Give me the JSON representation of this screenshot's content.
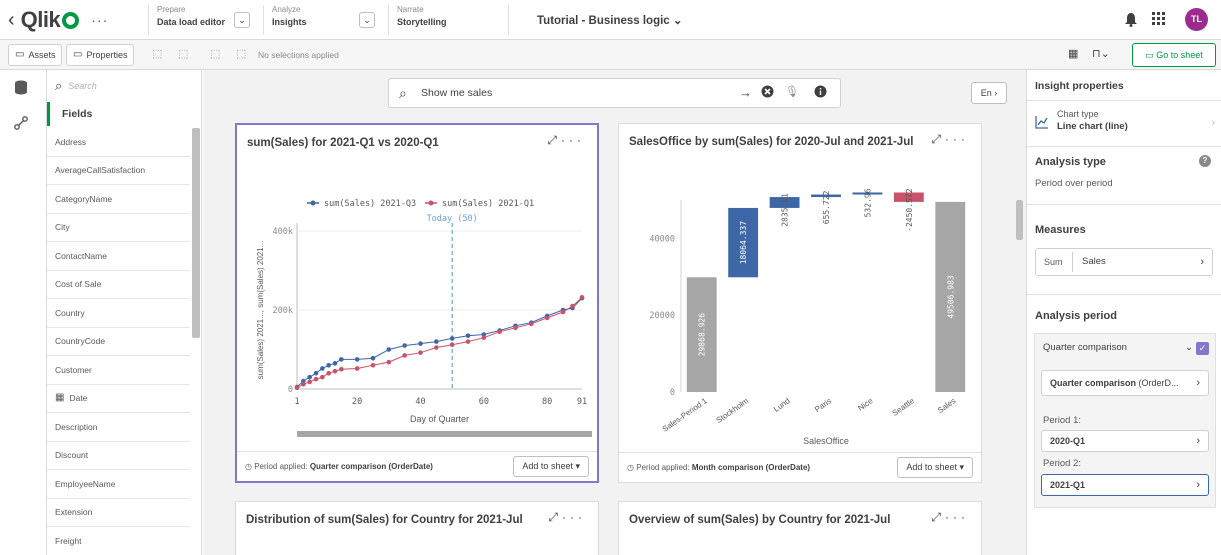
{
  "topbar": {
    "brand": "Qlik",
    "nav": [
      {
        "caption": "Prepare",
        "value": "Data load editor"
      },
      {
        "caption": "Analyze",
        "value": "Insights"
      },
      {
        "caption": "Narrate",
        "value": "Storytelling"
      }
    ],
    "app_title": "Tutorial - Business logic",
    "avatar_initials": "TL"
  },
  "toolbar": {
    "assets_label": "Assets",
    "properties_label": "Properties",
    "no_selections": "No selections applied",
    "goto_sheet": "Go to sheet"
  },
  "fields_panel": {
    "search_placeholder": "Search",
    "title": "Fields",
    "items": [
      "Address",
      "AverageCallSatisfaction",
      "CategoryName",
      "City",
      "ContactName",
      "Cost of Sale",
      "Country",
      "CountryCode",
      "Customer",
      "Date",
      "Description",
      "Discount",
      "EmployeeName",
      "Extension",
      "Freight"
    ]
  },
  "ask": {
    "query": "Show me sales",
    "language": "En"
  },
  "cards": {
    "line": {
      "title": "sum(Sales) for 2021-Q1 vs 2020-Q1",
      "footer_prefix": "Period applied:",
      "footer_value": "Quarter comparison (OrderDate)",
      "add_to_sheet": "Add to sheet"
    },
    "waterfall": {
      "title": "SalesOffice by sum(Sales) for 2020-Jul and 2021-Jul",
      "footer_prefix": "Period applied:",
      "footer_value": "Month comparison (OrderDate)",
      "add_to_sheet": "Add to sheet"
    },
    "dist": {
      "title": "Distribution of sum(Sales) for Country for 2021-Jul"
    },
    "overview": {
      "title": "Overview of sum(Sales) by Country for 2021-Jul"
    }
  },
  "chart_data": [
    {
      "type": "line",
      "title": "",
      "xlabel": "Day of Quarter",
      "ylabel": "sum(Sales) 2021..., sum(Sales) 2021...",
      "xlim": [
        1,
        91
      ],
      "ylim": [
        0,
        400000
      ],
      "xticks": [
        1,
        20,
        40,
        60,
        80,
        91
      ],
      "yticks": [
        0,
        200000,
        400000
      ],
      "ytick_labels": [
        "0",
        "200k",
        "400k"
      ],
      "legend_position": "top",
      "reference_line": {
        "x": 50,
        "label": "Today (50)"
      },
      "series": [
        {
          "name": "sum(Sales) 2021-Q3",
          "color": "#3e67a7",
          "x": [
            1,
            3,
            5,
            7,
            9,
            11,
            13,
            15,
            20,
            25,
            30,
            35,
            40,
            45,
            50,
            55,
            60,
            65,
            70,
            75,
            80,
            85,
            88,
            91
          ],
          "y": [
            5000,
            20000,
            30000,
            40000,
            52000,
            60000,
            65000,
            75000,
            75000,
            78000,
            100000,
            110000,
            115000,
            120000,
            128000,
            135000,
            138000,
            148000,
            160000,
            168000,
            185000,
            200000,
            205000,
            230000
          ]
        },
        {
          "name": "sum(Sales) 2021-Q1",
          "color": "#c9526b",
          "x": [
            1,
            3,
            5,
            7,
            9,
            11,
            13,
            15,
            20,
            25,
            30,
            35,
            40,
            45,
            50,
            55,
            60,
            65,
            70,
            75,
            80,
            85,
            88,
            91
          ],
          "y": [
            3000,
            12000,
            18000,
            25000,
            30000,
            40000,
            45000,
            50000,
            52000,
            60000,
            68000,
            85000,
            92000,
            105000,
            112000,
            120000,
            130000,
            145000,
            155000,
            165000,
            180000,
            195000,
            210000,
            232000
          ]
        }
      ]
    },
    {
      "type": "bar",
      "subtype": "waterfall",
      "xlabel": "SalesOffice",
      "ylabel": "",
      "ylim": [
        0,
        50000
      ],
      "yticks": [
        0,
        20000,
        40000
      ],
      "categories": [
        "Sales-Period 1",
        "Stockholm",
        "Lund",
        "Paris",
        "Nice",
        "Seattle",
        "Sales"
      ],
      "values": [
        29868.926,
        18064.337,
        2835.61,
        655.722,
        532.96,
        -2450.572,
        49506.983
      ],
      "labels": [
        "29868.926",
        "18064.337",
        "2835.61",
        "655.722",
        "532.96",
        "-2450.572",
        "49506.983"
      ],
      "totals": [
        true,
        false,
        false,
        false,
        false,
        false,
        true
      ],
      "colors": {
        "total": "#a6a6a6",
        "increase": "#3e67a7",
        "decrease": "#c9526b"
      }
    }
  ],
  "insight_properties": {
    "title": "Insight properties",
    "chart_type_label": "Chart type",
    "chart_type_value": "Line chart (line)",
    "analysis_type_title": "Analysis type",
    "analysis_type_value": "Period over period",
    "measures_title": "Measures",
    "measure_agg": "Sum",
    "measure_field": "Sales",
    "analysis_period_title": "Analysis period",
    "period_mode": "Quarter comparison",
    "period_detail_name": "Quarter comparison",
    "period_detail_suffix": "(OrderD...",
    "period1_label": "Period 1:",
    "period1_value": "2020-Q1",
    "period2_label": "Period 2:",
    "period2_value": "2021-Q1"
  }
}
